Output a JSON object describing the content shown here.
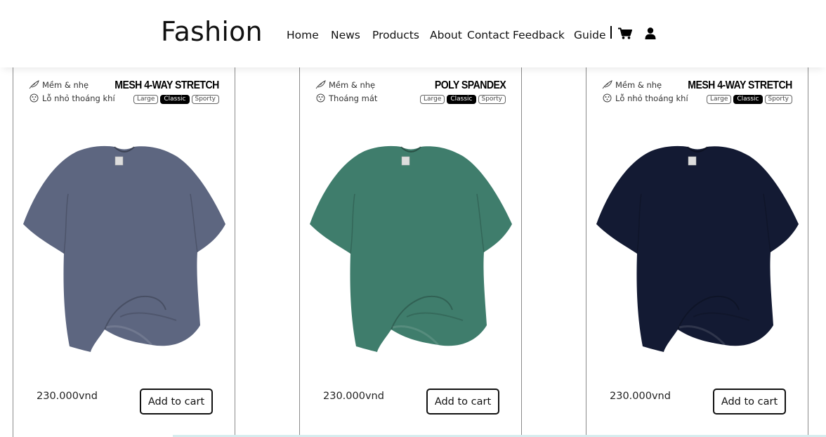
{
  "header": {
    "brand": "Fashion",
    "nav": [
      "Home",
      "News",
      "Products",
      "About",
      "Contact",
      "Feedback",
      "Guide"
    ],
    "icons": [
      "cart-icon",
      "user-icon"
    ]
  },
  "products": [
    {
      "features": [
        "Mềm & nhẹ",
        "Lỗ nhỏ thoáng khí"
      ],
      "fabric": "MESH 4-WAY STRETCH",
      "fits": [
        "Large",
        "Classic",
        "Sporty"
      ],
      "active_fit": "Classic",
      "shirt_color": "#5d6680",
      "price": "230.000vnd",
      "button": "Add to cart"
    },
    {
      "features": [
        "Mềm & nhẹ",
        "Thoáng mát"
      ],
      "fabric": "POLY SPANDEX",
      "fits": [
        "Large",
        "Classic",
        "Sporty"
      ],
      "active_fit": "Classic",
      "shirt_color": "#3f7d6c",
      "price": "230.000vnd",
      "button": "Add to cart"
    },
    {
      "features": [
        "Mềm & nhẹ",
        "Lỗ nhỏ thoáng khí"
      ],
      "fabric": "MESH 4-WAY STRETCH",
      "fits": [
        "Large",
        "Classic",
        "Sporty"
      ],
      "active_fit": "Classic",
      "shirt_color": "#131a33",
      "price": "230.000vnd",
      "button": "Add to cart"
    }
  ]
}
